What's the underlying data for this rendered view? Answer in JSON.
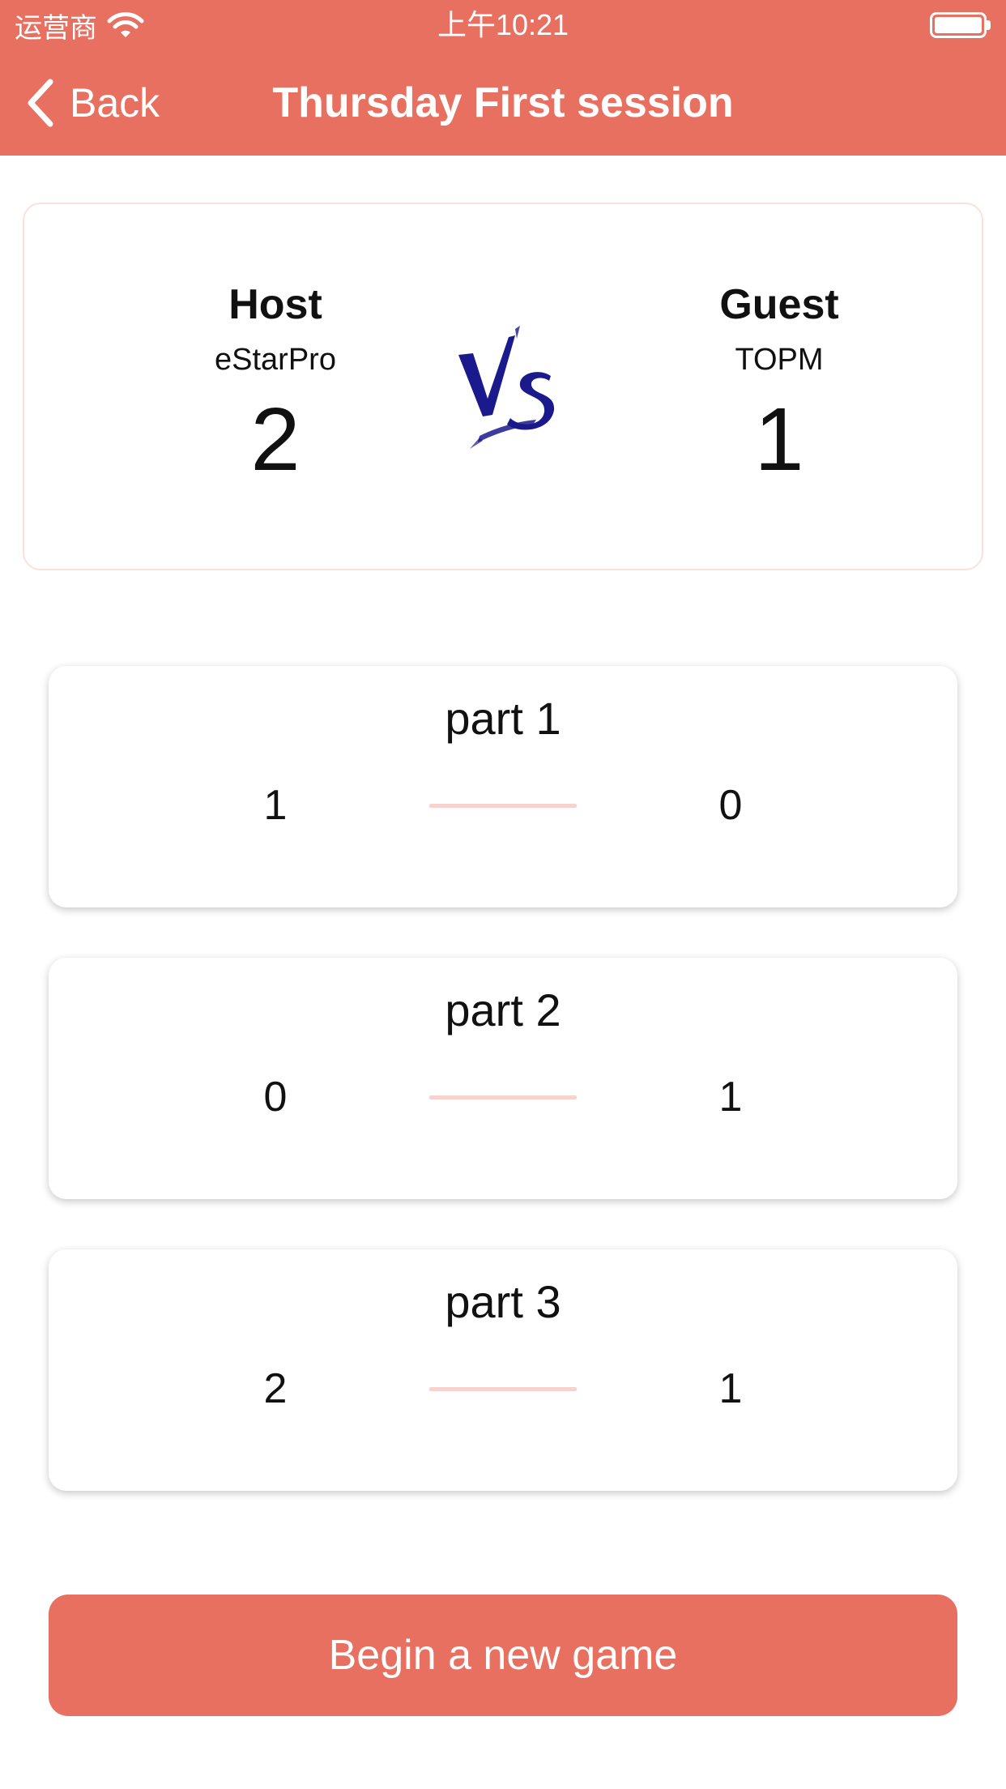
{
  "status_bar": {
    "carrier": "运营商",
    "time": "上午10:21",
    "battery_level": 1.0
  },
  "nav": {
    "back_label": "Back",
    "title": "Thursday First session"
  },
  "match": {
    "host": {
      "role": "Host",
      "name": "eStarPro",
      "score": "2"
    },
    "guest": {
      "role": "Guest",
      "name": "TOPM",
      "score": "1"
    },
    "vs_icon": "vs-logo-icon"
  },
  "parts": [
    {
      "title": "part 1",
      "host_score": "1",
      "guest_score": "0"
    },
    {
      "title": "part 2",
      "host_score": "0",
      "guest_score": "1"
    },
    {
      "title": "part 3",
      "host_score": "2",
      "guest_score": "1"
    }
  ],
  "actions": {
    "new_game_label": "Begin a new game"
  },
  "colors": {
    "accent": "#e87060",
    "divider": "#f6d3cd",
    "vs_blue": "#1a1a8c"
  }
}
